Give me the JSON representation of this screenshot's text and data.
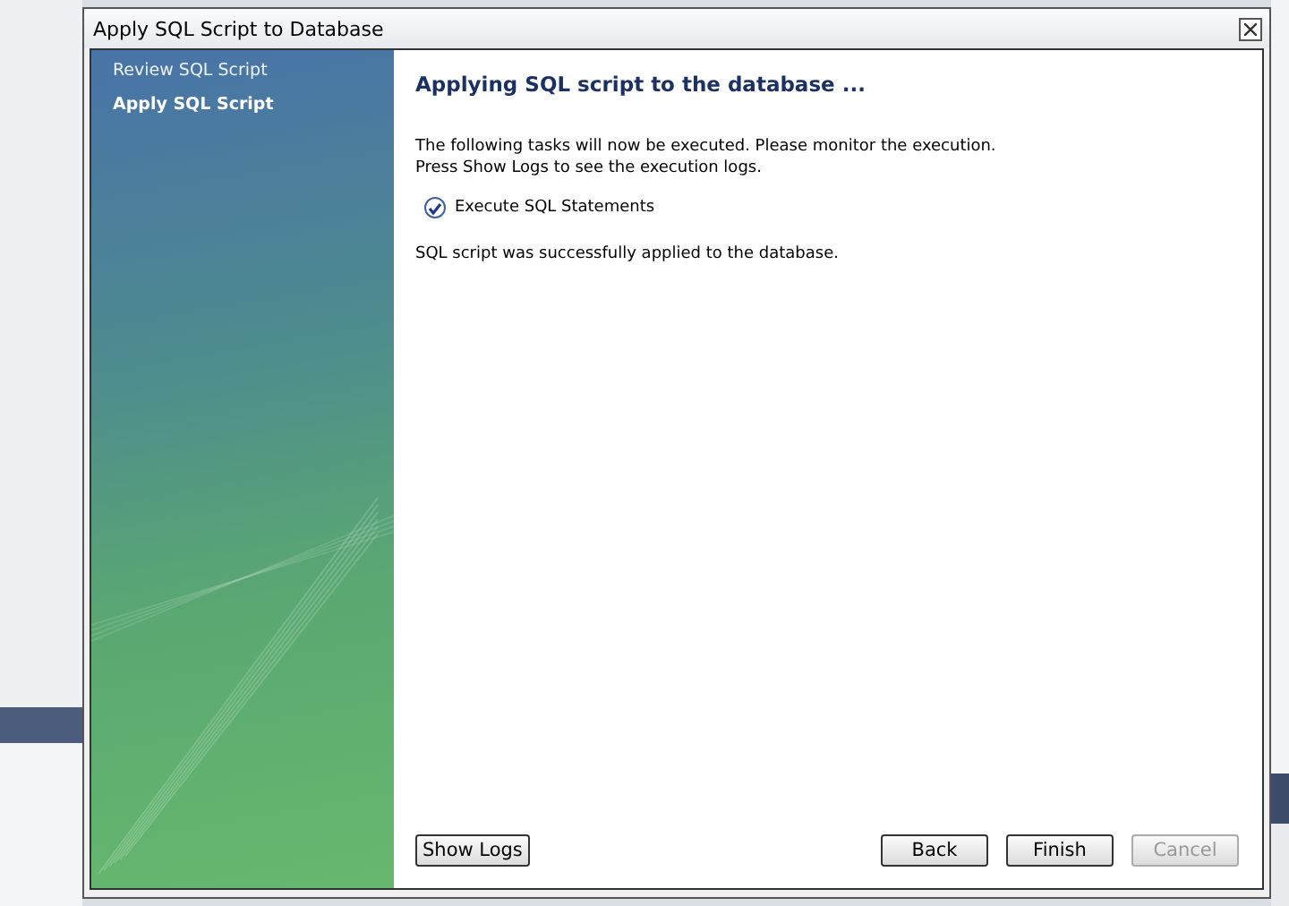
{
  "window": {
    "title": "Apply SQL Script to Database"
  },
  "steps": [
    {
      "label": "Review SQL Script",
      "selected": false
    },
    {
      "label": "Apply SQL Script",
      "selected": true
    }
  ],
  "heading": "Applying SQL script to the database ...",
  "intro": [
    "The following tasks will now be executed. Please monitor the execution.",
    "Press Show Logs to see the execution logs."
  ],
  "tasks": [
    {
      "label": "Execute SQL Statements",
      "checked": true
    }
  ],
  "result": "SQL script was successfully applied to the database.",
  "buttons": [
    {
      "label": "Show Logs",
      "disabled": false
    },
    {
      "label": "Back",
      "disabled": false
    },
    {
      "label": "Finish",
      "disabled": false
    },
    {
      "label": "Cancel",
      "disabled": true
    }
  ]
}
